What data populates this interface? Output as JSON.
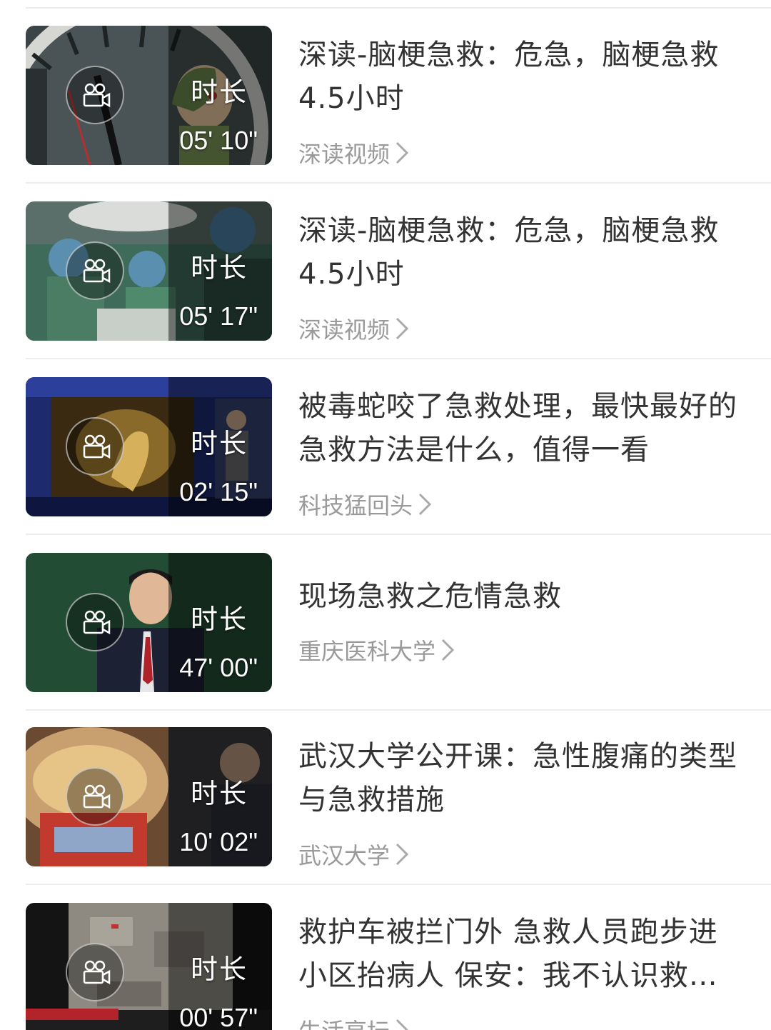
{
  "list": {
    "duration_label": "时长",
    "items": [
      {
        "title": "深读-脑梗急救：危急，脑梗急救4.5小时",
        "source": "深读视频",
        "duration": "05' 10\"",
        "thumb": "clock-cartoon"
      },
      {
        "title": "深读-脑梗急救：危急，脑梗急救4.5小时",
        "source": "深读视频",
        "duration": "05' 17\"",
        "thumb": "surgery"
      },
      {
        "title": "被毒蛇咬了急救处理，最快最好的急救方法是什么，值得一看",
        "source": "科技猛回头",
        "duration": "02' 15\"",
        "thumb": "snake-studio"
      },
      {
        "title": "现场急救之危情急救",
        "source": "重庆医科大学",
        "duration": "47' 00\"",
        "thumb": "lecturer"
      },
      {
        "title": "武汉大学公开课：急性腹痛的类型与急救措施",
        "source": "武汉大学",
        "duration": "10' 02\"",
        "thumb": "hotpot"
      },
      {
        "title": "救护车被拦门外 急救人员跑步进小区抬病人 保安：我不认识救…",
        "source": "生活享坛",
        "duration": "00' 57\"",
        "thumb": "aerial-news"
      }
    ]
  },
  "icons": {
    "play": "video-camera-icon",
    "chevron": "chevron-right-icon"
  }
}
